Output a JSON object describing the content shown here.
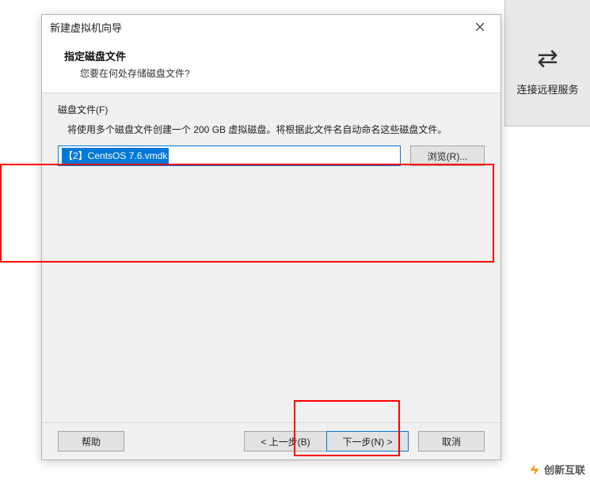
{
  "right_panel": {
    "label": "连接远程服务"
  },
  "dialog": {
    "title": "新建虚拟机向导",
    "heading": "指定磁盘文件",
    "subtext": "您要在何处存储磁盘文件?",
    "group_label": "磁盘文件(F)",
    "group_desc": "将使用多个磁盘文件创建一个 200 GB 虚拟磁盘。将根据此文件名自动命名这些磁盘文件。",
    "file_value": "【2】CentsOS 7.6.vmdk",
    "browse_label": "浏览(R)...",
    "help_label": "帮助",
    "back_label": "< 上一步(B)",
    "next_label": "下一步(N) >",
    "cancel_label": "取消"
  },
  "watermark": "创新互联"
}
